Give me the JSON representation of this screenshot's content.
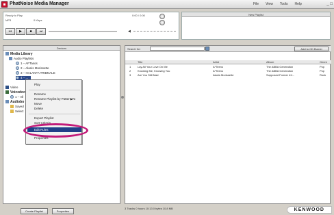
{
  "app": {
    "title": "PhatNoise Media Manager",
    "menu": [
      "File",
      "View",
      "Tools",
      "Help"
    ],
    "window_controls": "_ □"
  },
  "player": {
    "status": "Ready to Play",
    "time": "0:00 / 0:00",
    "format": "MP3",
    "bitrate": "0 Kbps",
    "controls": [
      "⏮",
      "▶",
      "■",
      "⏭"
    ]
  },
  "new_playlist": {
    "label": "New Playlist"
  },
  "device": {
    "header": "Devices",
    "tree": [
      {
        "label": "Media Library",
        "icon": "library-icon"
      },
      {
        "label": "Audio Playlists",
        "icon": "playlist-icon"
      },
      {
        "label": "1 – AFTasos",
        "icon": "disc-icon"
      },
      {
        "label": "2 – Alanis Morissette",
        "icon": "disc-icon"
      },
      {
        "label": "3 – HALAKFA TRIBNALE",
        "icon": "disc-icon"
      },
      {
        "label": "4 – ...",
        "icon": "disc-icon"
      },
      {
        "label": "Video",
        "icon": "video-icon"
      },
      {
        "label": "Voicedoc",
        "icon": "audio-icon"
      },
      {
        "label": "1 – All",
        "icon": "disc-icon"
      },
      {
        "label": "Audiobo",
        "icon": "audiobook-icon"
      },
      {
        "label": "Saved",
        "icon": "folder-icon"
      },
      {
        "label": "Select",
        "icon": "folder-icon"
      }
    ],
    "footer_buttons": [
      "Create Playlist",
      "Properties"
    ]
  },
  "context_menu": {
    "items": [
      "Play",
      "Rename",
      "Rename Playlist by Pattern To",
      "Move",
      "Delete",
      "Export Playlist",
      "Sort Criteria",
      "Edit Rules",
      "Properties"
    ],
    "active": "Edit Rules"
  },
  "content": {
    "search_label": "Search for:",
    "add_cd_button": "Add to CD Burner",
    "columns": [
      "",
      "Title",
      "Artist",
      "Album",
      "Genre"
    ],
    "rows": [
      [
        "1",
        "Lay All Your Love On Me",
        "A*Teens",
        "The ABBA Generation",
        "Pop"
      ],
      [
        "2",
        "Knowing Me, Knowing You",
        "A*Teens",
        "The ABBA Generation",
        "Pop"
      ],
      [
        "3",
        "Are You Still Mad",
        "Alanis Morissette",
        "Supposed Former Inf...",
        "Rock"
      ]
    ]
  },
  "status_bar": "3 Tracks   0 hours 10:13   0 bytes 10.8 MB",
  "brand": "KENWOOD",
  "colors": {
    "accent": "#c21a79",
    "selection": "#1f3f88"
  }
}
